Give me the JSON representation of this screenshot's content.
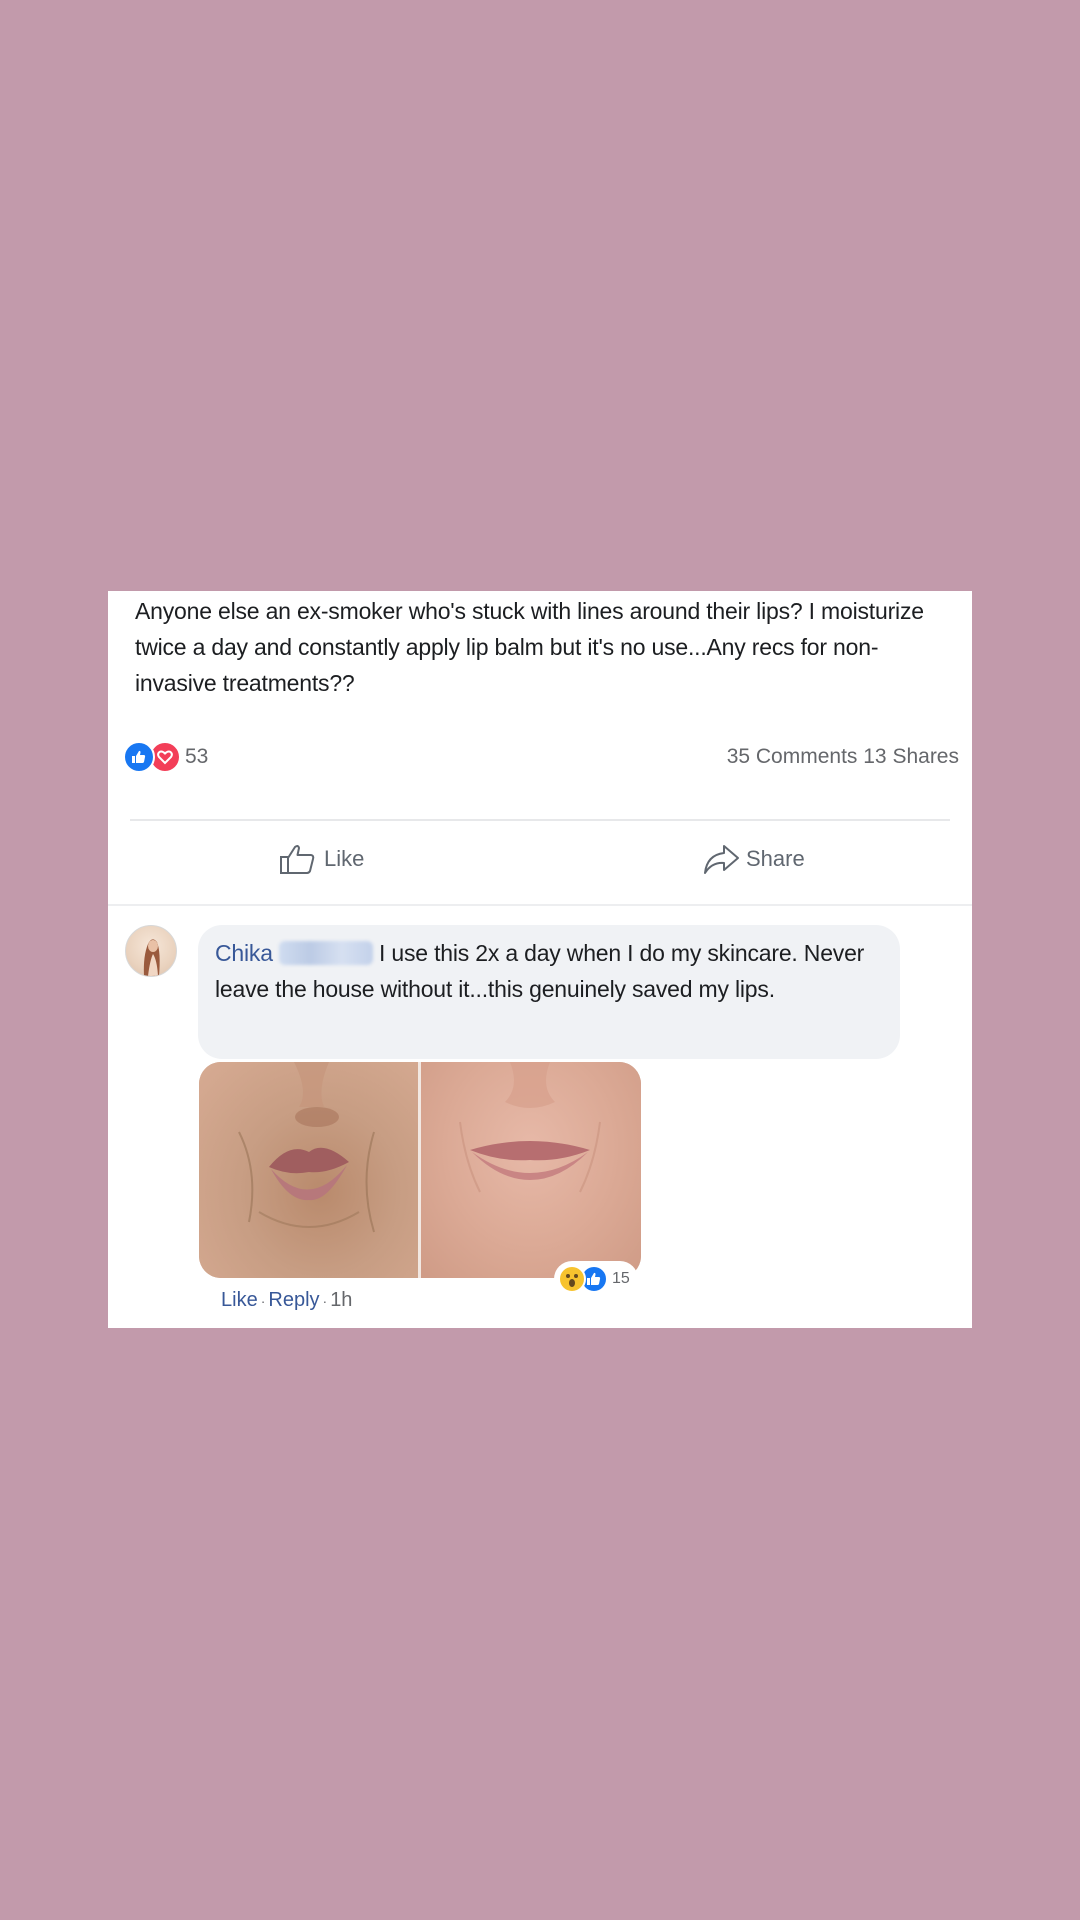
{
  "post": {
    "text": "Anyone else an ex-smoker who's stuck with lines around their lips? I moisturize twice a day and constantly apply lip balm but it's no use...Any recs for non-invasive treatments??",
    "reaction_count": "53",
    "counts_text": "35 Comments 13 Shares",
    "reaction_icons": [
      "like-icon",
      "love-icon"
    ]
  },
  "actions": {
    "like_label": "Like",
    "share_label": "Share"
  },
  "comment": {
    "author": "Chika",
    "text": "I use this 2x a day when I do my skincare. Never leave the house without it...this genuinely saved my lips.",
    "reaction_icons": [
      "wow-icon",
      "like-icon"
    ],
    "reaction_count": "15",
    "like_link": "Like",
    "reply_link": "Reply",
    "separator": "·",
    "timestamp": "1h"
  },
  "colors": {
    "background": "#c29aab",
    "card": "#ffffff",
    "link_blue": "#385898",
    "like_blue": "#1877f2",
    "love_red": "#f33e58",
    "bubble": "#f0f2f5"
  }
}
